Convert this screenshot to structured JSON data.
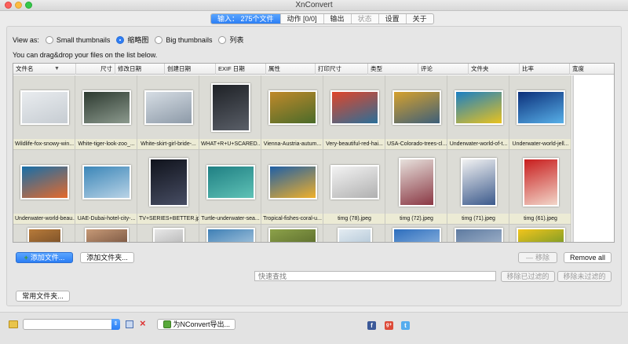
{
  "window": {
    "title": "XnConvert"
  },
  "tabs": [
    {
      "label": "输入： 275个文件",
      "active": true,
      "disabled": false
    },
    {
      "label": "动作 [0/0]",
      "active": false,
      "disabled": false
    },
    {
      "label": "输出",
      "active": false,
      "disabled": false
    },
    {
      "label": "状态",
      "active": false,
      "disabled": true
    },
    {
      "label": "设置",
      "active": false,
      "disabled": false
    },
    {
      "label": "关于",
      "active": false,
      "disabled": false
    }
  ],
  "view_as": {
    "label": "View as:",
    "options": [
      {
        "label": "Small thumbnails",
        "checked": false
      },
      {
        "label": "缩略图",
        "checked": true
      },
      {
        "label": "Big thumbnails",
        "checked": false
      },
      {
        "label": "列表",
        "checked": false
      }
    ]
  },
  "hint": "You can drag&drop your files on the list below.",
  "columns": [
    "文件名",
    "尺寸",
    "修改日期",
    "创建日期",
    "EXIF 日期",
    "属性",
    "打印尺寸",
    "类型",
    "评论",
    "文件夹",
    "比率",
    "宽度"
  ],
  "thumbnails": [
    {
      "caption": "Wildlife-fox-snowy-win...",
      "colors": [
        "#e9ecef",
        "#c6ccd2"
      ]
    },
    {
      "caption": "White-tiger-look-zoo_...",
      "colors": [
        "#2d3a30",
        "#8c9a8e"
      ]
    },
    {
      "caption": "White-skirt-girl-bride-...",
      "colors": [
        "#d6dde4",
        "#8d9aa8"
      ]
    },
    {
      "caption": "WHAT+R+U+SCARED...",
      "colors": [
        "#1e2126",
        "#5a5f68"
      ]
    },
    {
      "caption": "Vienna-Austria-autum...",
      "colors": [
        "#c0892a",
        "#4a6b2a"
      ]
    },
    {
      "caption": "Very-beautiful-red-hai...",
      "colors": [
        "#e0452a",
        "#2b6f99"
      ]
    },
    {
      "caption": "USA-Colorado-trees-cl...",
      "colors": [
        "#d6a12d",
        "#3d5f7a"
      ]
    },
    {
      "caption": "Underwater-world-of-t...",
      "colors": [
        "#1a7fc4",
        "#e9c21e"
      ]
    },
    {
      "caption": "Underwater-world-jell...",
      "colors": [
        "#0b2f7a",
        "#58b0e8"
      ]
    },
    {
      "caption": "Underwater-world-beau...",
      "colors": [
        "#166ea9",
        "#e56a2c"
      ]
    },
    {
      "caption": "UAE-Dubai-hotel-city-...",
      "colors": [
        "#3b86b8",
        "#b9d3e6"
      ]
    },
    {
      "caption": "TV+SERIES+BETTER.jpg",
      "colors": [
        "#10131c",
        "#474d63"
      ]
    },
    {
      "caption": "Turtle-underwater-sea...",
      "colors": [
        "#1f7f83",
        "#5fc2b6"
      ]
    },
    {
      "caption": "Tropical-fishes-coral-u...",
      "colors": [
        "#1f5fa6",
        "#f0b02a"
      ]
    },
    {
      "caption": "timg (78).jpeg",
      "colors": [
        "#f3f3f3",
        "#b0b0b0"
      ]
    },
    {
      "caption": "timg (72).jpeg",
      "colors": [
        "#e7e1dc",
        "#8a3844"
      ]
    },
    {
      "caption": "timg (71).jpeg",
      "colors": [
        "#f2f2f2",
        "#3c5a8c"
      ]
    },
    {
      "caption": "timg (61).jpeg",
      "colors": [
        "#c81d1d",
        "#f2d6c9"
      ]
    },
    {
      "caption": "",
      "colors": [
        "#b87b3a",
        "#5c3b20"
      ]
    },
    {
      "caption": "",
      "colors": [
        "#c79a77",
        "#5a3a2c"
      ]
    },
    {
      "caption": "",
      "colors": [
        "#e8e8e8",
        "#a0a0a0"
      ]
    },
    {
      "caption": "",
      "colors": [
        "#3e7fb5",
        "#c8dcea"
      ]
    },
    {
      "caption": "",
      "colors": [
        "#8da24a",
        "#4a5a23"
      ]
    },
    {
      "caption": "",
      "colors": [
        "#e4ecf2",
        "#9fb8cc"
      ]
    },
    {
      "caption": "",
      "colors": [
        "#2c6dbd",
        "#a9c8e8"
      ]
    },
    {
      "caption": "",
      "colors": [
        "#5d7aa0",
        "#b8c6d8"
      ]
    },
    {
      "caption": "",
      "colors": [
        "#f3c51c",
        "#4b8a2b"
      ]
    }
  ],
  "buttons": {
    "add_files": "添加文件...",
    "add_folder": "添加文件夹...",
    "remove": "移除",
    "remove_all": "Remove all",
    "remove_filtered": "移除已过滤的",
    "remove_unfiltered": "移除未过滤的",
    "common_folder": "常用文件夹...",
    "export": "为NConvert导出..."
  },
  "search": {
    "placeholder": "快速查找",
    "value": ""
  },
  "bottom_combo": {
    "value": ""
  },
  "social": {
    "facebook": "f",
    "google": "g+",
    "twitter": "t"
  }
}
